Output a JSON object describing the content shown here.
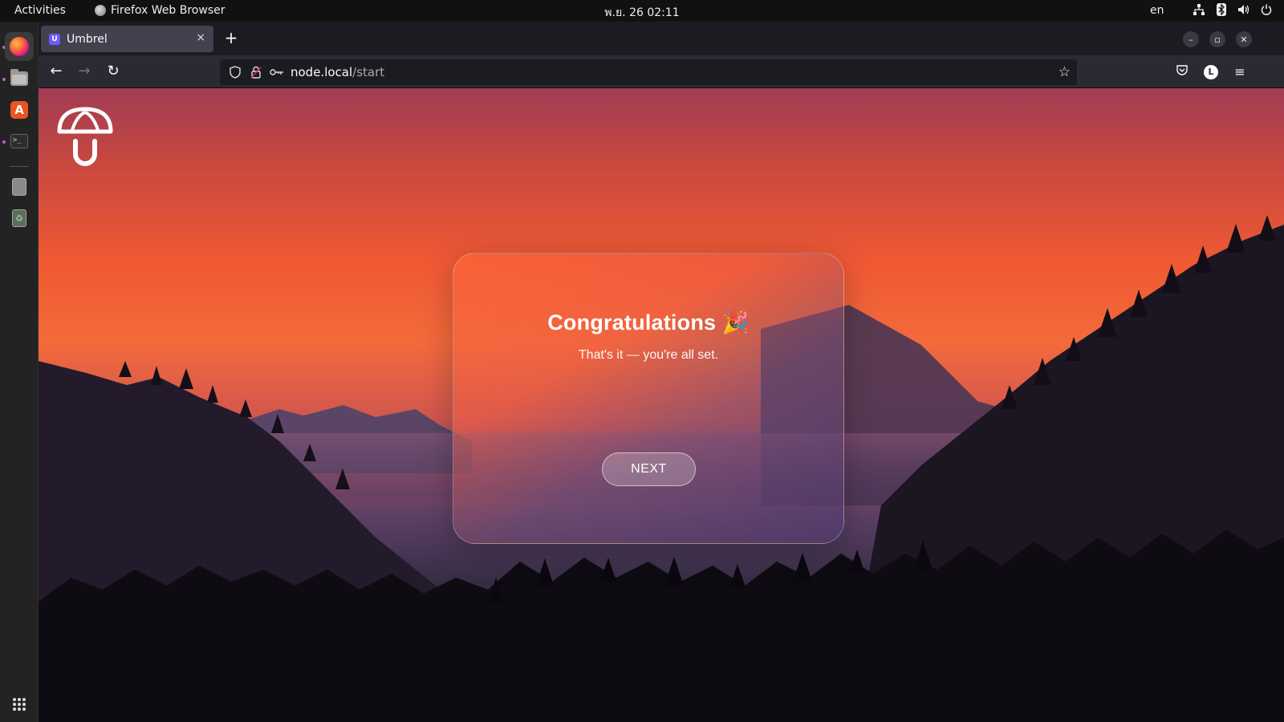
{
  "system_bar": {
    "activities": "Activities",
    "app_name": "Firefox Web Browser",
    "clock": "พ.ย. 26  02:11",
    "language": "en",
    "tray_icons": [
      "network-icon",
      "bluetooth-icon",
      "volume-icon",
      "power-icon"
    ]
  },
  "dock": {
    "items": [
      "firefox-icon",
      "files-icon",
      "app-store-icon",
      "terminal-icon",
      "disk-icon",
      "trash-icon"
    ],
    "show_apps_icon": "apps-grid-icon"
  },
  "browser": {
    "tab": {
      "title": "Umbrel",
      "favicon": "U",
      "close_glyph": "×"
    },
    "new_tab_glyph": "+",
    "url": {
      "host": "node.local",
      "path": "/start"
    }
  },
  "page": {
    "title": "Congratulations 🎉",
    "subtitle": "That's it — you're all set.",
    "next_label": "NEXT"
  },
  "colors": {
    "accent_sky": "#f05a33",
    "card_border": "rgba(255,255,255,0.28)",
    "favicon": "#6b5bff"
  }
}
